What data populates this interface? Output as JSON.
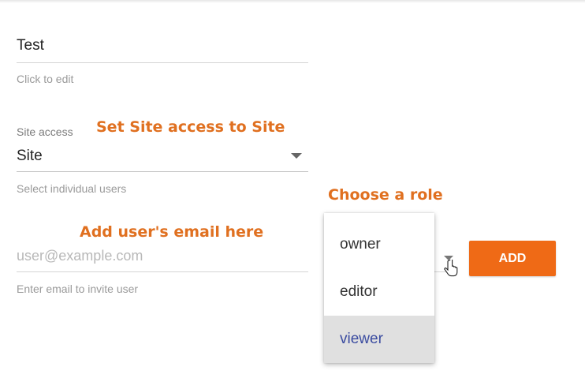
{
  "name_field": {
    "value": "Test",
    "hint": "Click to edit"
  },
  "site_access": {
    "label": "Site access",
    "value": "Site",
    "hint": "Select individual users"
  },
  "email_field": {
    "placeholder": "user@example.com",
    "hint": "Enter email to invite user"
  },
  "role_menu": {
    "options": [
      "owner",
      "editor",
      "viewer"
    ],
    "highlighted": "viewer"
  },
  "add_button": {
    "label": "ADD"
  },
  "annotations": {
    "site_access": "Set Site access to Site",
    "role": "Choose a role",
    "email": "Add user's email here"
  },
  "colors": {
    "accent": "#ef6a16",
    "annotation": "#e07020",
    "selected_text": "#3a4ba0",
    "selected_bg": "#e0e0e0"
  }
}
